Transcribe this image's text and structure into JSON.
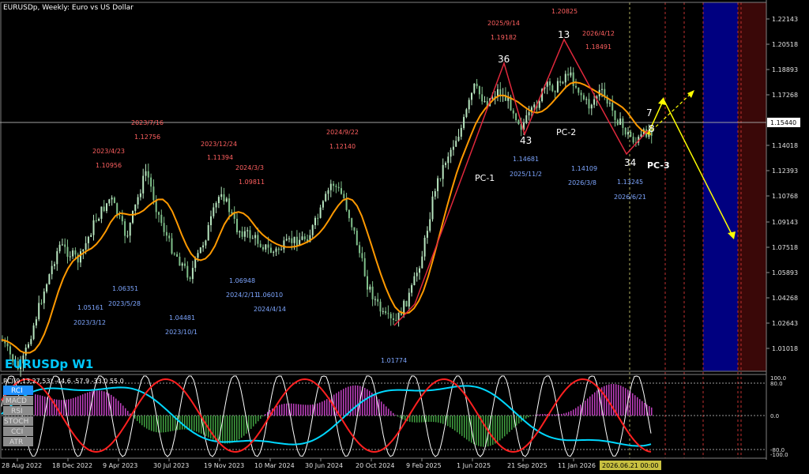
{
  "window": {
    "title": "EURUSDp, Weekly:  Euro vs US Dollar",
    "symbol_label": "EURUSDp W1"
  },
  "price_axis": {
    "labels": [
      "1.22143",
      "1.20518",
      "1.18893",
      "1.17268",
      "1.15440",
      "1.14018",
      "1.12393",
      "1.10768",
      "1.09143",
      "1.07518",
      "1.05893",
      "1.04268",
      "1.02643",
      "1.01018"
    ],
    "current_price": "1.15440"
  },
  "time_axis": {
    "labels": [
      "28 Aug 2022",
      "18 Dec 2022",
      "9 Apr 2023",
      "30 Jul 2023",
      "19 Nov 2023",
      "10 Mar 2024",
      "30 Jun 2024",
      "20 Oct 2024",
      "9 Feb 2025",
      "1 Jun 2025",
      "21 Sep 2025",
      "11 Jan 2026",
      "2026.06.21 00:00"
    ]
  },
  "annotations": {
    "highs": [
      {
        "date": "2023/4/23",
        "price": "1.10956"
      },
      {
        "date": "2023/7/16",
        "price": "1.12756"
      },
      {
        "date": "2023/12/24",
        "price": "1.11394"
      },
      {
        "date": "2024/3/3",
        "price": "1.09811"
      },
      {
        "date": "2024/9/22",
        "price": "1.12140"
      },
      {
        "date": "2025/9/14",
        "price": "1.19182"
      },
      {
        "date": "",
        "price": "1.20825"
      },
      {
        "date": "2026/4/12",
        "price": "1.18491"
      }
    ],
    "lows": [
      {
        "date": "2023/3/12",
        "price": "1.05161"
      },
      {
        "date": "2023/5/28",
        "price": "1.06351"
      },
      {
        "date": "2023/10/1",
        "price": "1.04481"
      },
      {
        "date": "2024/2/11",
        "price": "1.06948"
      },
      {
        "date": "2024/4/14",
        "price": "1.06010"
      },
      {
        "date": "",
        "price": "1.01774"
      },
      {
        "date": "2025/11/2",
        "price": "1.14681"
      },
      {
        "date": "2026/3/8",
        "price": "1.14109"
      },
      {
        "date": "2026/6/21",
        "price": "1.13245"
      }
    ],
    "wave_numbers": [
      "36",
      "13",
      "43",
      "34",
      "7",
      "8"
    ],
    "pc_labels": [
      "PC-1",
      "PC-2",
      "PC-3"
    ]
  },
  "indicator": {
    "header": "RCI(9,13,27,53) -44.6 -57.9 -33.0 55.0",
    "levels": [
      "100.0",
      "80.0",
      "0.0",
      "-80.0",
      "-100.0"
    ],
    "buttons": [
      "RCI",
      "MACD",
      "RSI",
      "STOCH",
      "CCI",
      "ATR"
    ],
    "active_button": "RCI"
  },
  "colors": {
    "background": "#000000",
    "candle_up": "#b8e6c0",
    "candle_down": "#7fbf8a",
    "ma": "#ff9900",
    "wave_line": "#e0283c",
    "arrow": "#ffff00",
    "high_label": "#ff6060",
    "low_label": "#7ea6ff",
    "rci_short": "#ffffff",
    "rci_mid": "#ff2020",
    "rci_long": "#00d8ff",
    "hist_pos": "#c040c0",
    "hist_neg": "#40a040",
    "band_blue": "#000080",
    "band_red": "#3a0808",
    "active_button_bg": "#1e90ff"
  }
}
